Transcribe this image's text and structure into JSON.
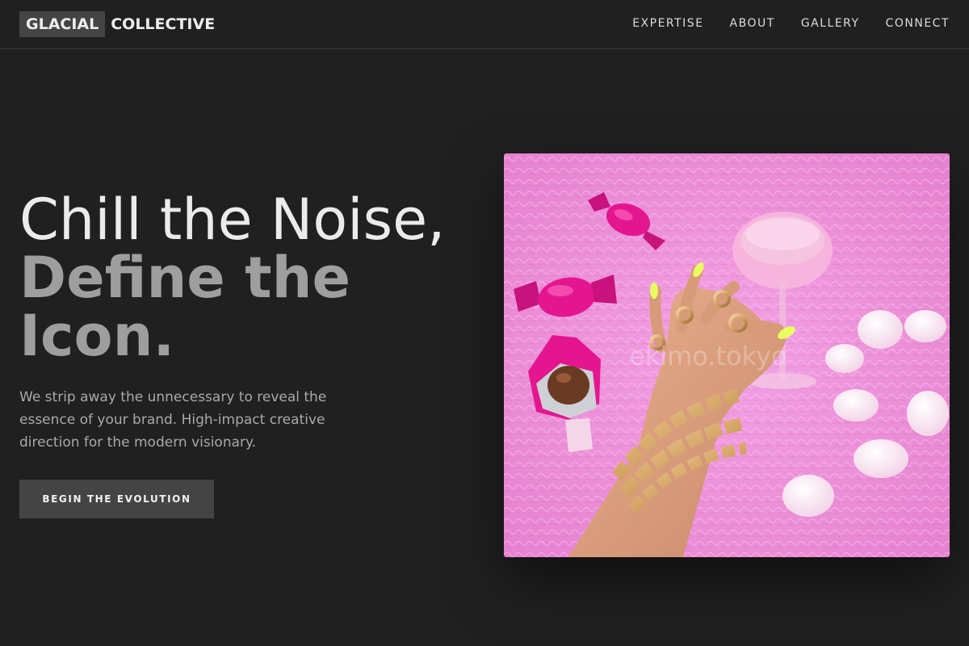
{
  "header": {
    "logo_mark": "GLACIAL",
    "logo_rest": "COLLECTIVE",
    "nav": [
      "EXPERTISE",
      "ABOUT",
      "GALLERY",
      "CONNECT"
    ]
  },
  "hero": {
    "title_line1": "Chill the Noise,",
    "title_line2": "Define the Icon.",
    "description": "We strip away the unnecessary to reveal the essence of your brand. High-impact creative direction for the modern visionary.",
    "cta_label": "BEGIN THE EVOLUTION"
  },
  "image": {
    "watermark": "ekimo.tokyo"
  },
  "colors": {
    "background": "#202020",
    "button": "#444444",
    "accent_pink": "#f08ad8"
  }
}
